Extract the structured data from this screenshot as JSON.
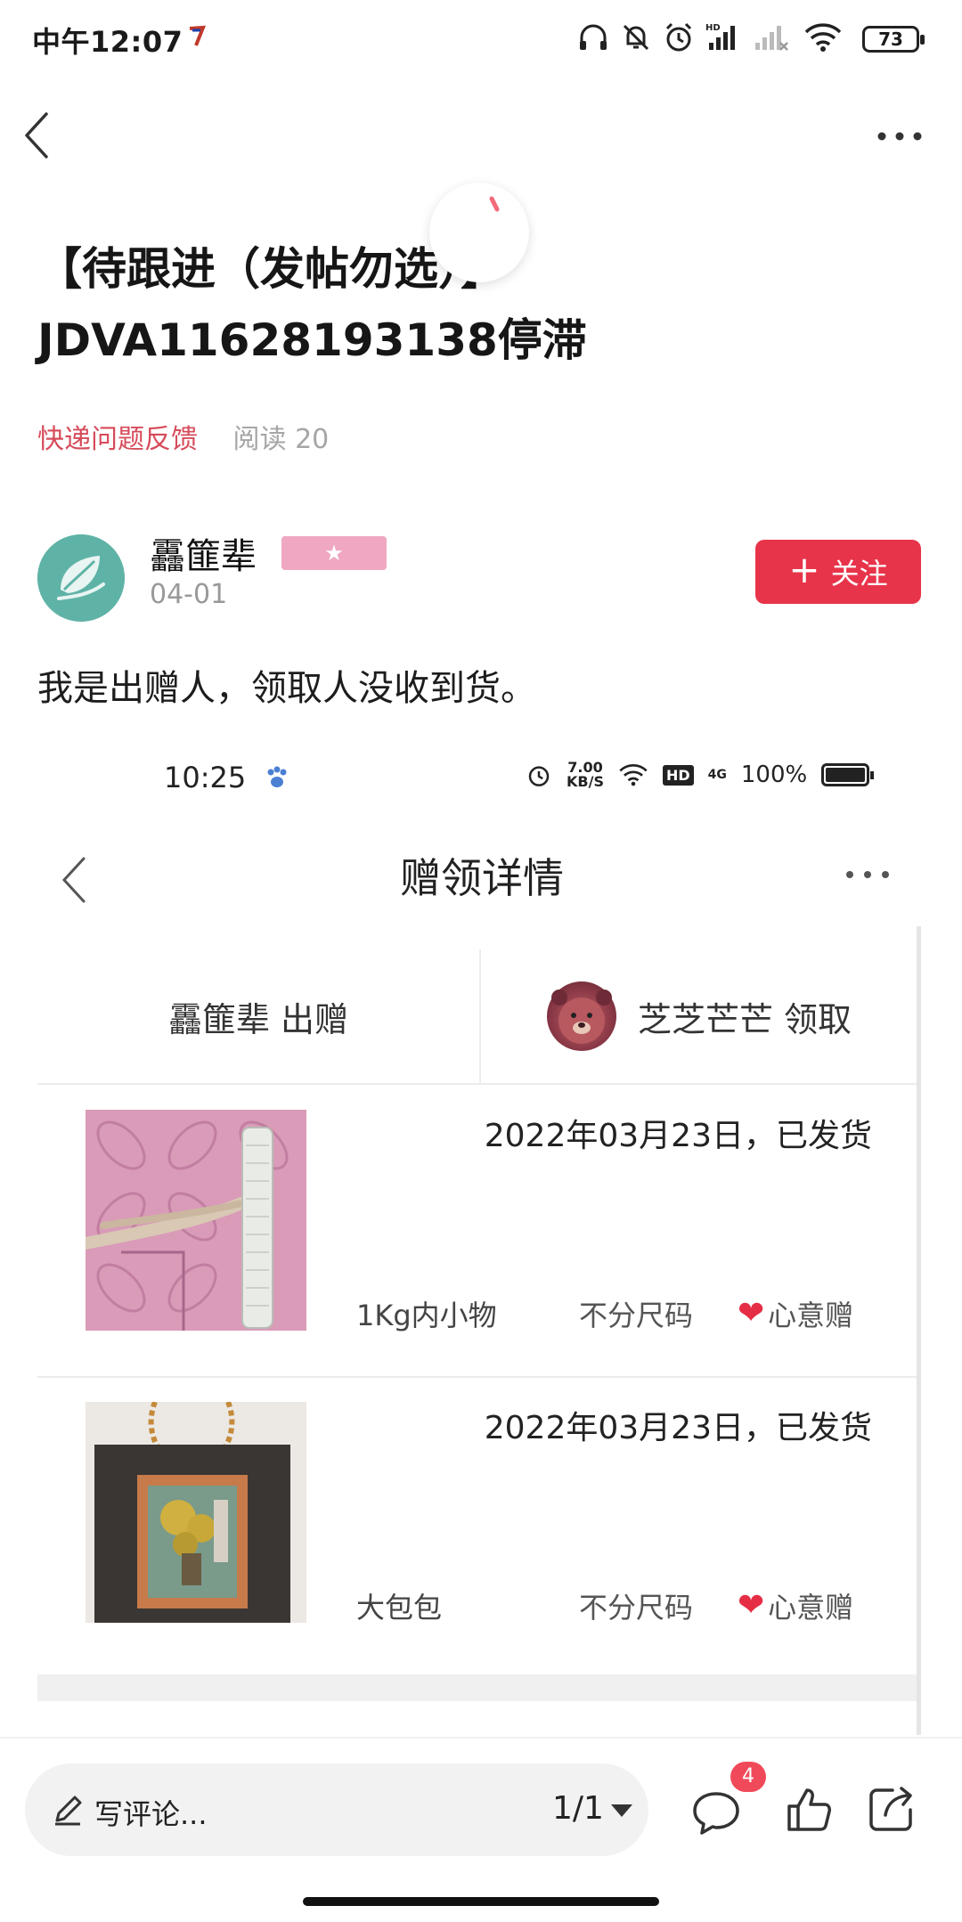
{
  "status_bar": {
    "time": "中午12:07",
    "battery": "73"
  },
  "nav": {
    "back_icon": "chevron-left-icon",
    "more_icon": "more-horizontal-icon"
  },
  "post": {
    "title": "【待跟进（发帖勿选）】JDVA11628193138停滞",
    "category": "快递问题反馈",
    "reads": "阅读 20",
    "author": {
      "name": "靐篚辈",
      "badge": "★",
      "date": "04-01",
      "follow_label": "关注"
    },
    "body": "我是出赠人，领取人没收到货。"
  },
  "embedded_screenshot": {
    "time": "10:25",
    "speed": "7.00",
    "speed_unit": "KB/S",
    "hd": "HD",
    "network": "4G",
    "battery": "100%",
    "title": "赠领详情",
    "giver": "靐篚辈 出赠",
    "receiver": "芝芝芒芒 领取",
    "items": [
      {
        "status": "2022年03月23日，已发货",
        "name": "1Kg内小物",
        "size": "不分尺码",
        "gift": "心意赠"
      },
      {
        "status": "2022年03月23日，已发货",
        "name": "大包包",
        "size": "不分尺码",
        "gift": "心意赠"
      }
    ]
  },
  "bottom_bar": {
    "comment_placeholder": "写评论...",
    "page": "1/1",
    "comment_count": "4"
  },
  "colors": {
    "accent_red": "#e8344a",
    "category_red": "#d64b5a",
    "badge_pink": "#f0a8c2",
    "avatar_teal": "#5fb3a6"
  }
}
